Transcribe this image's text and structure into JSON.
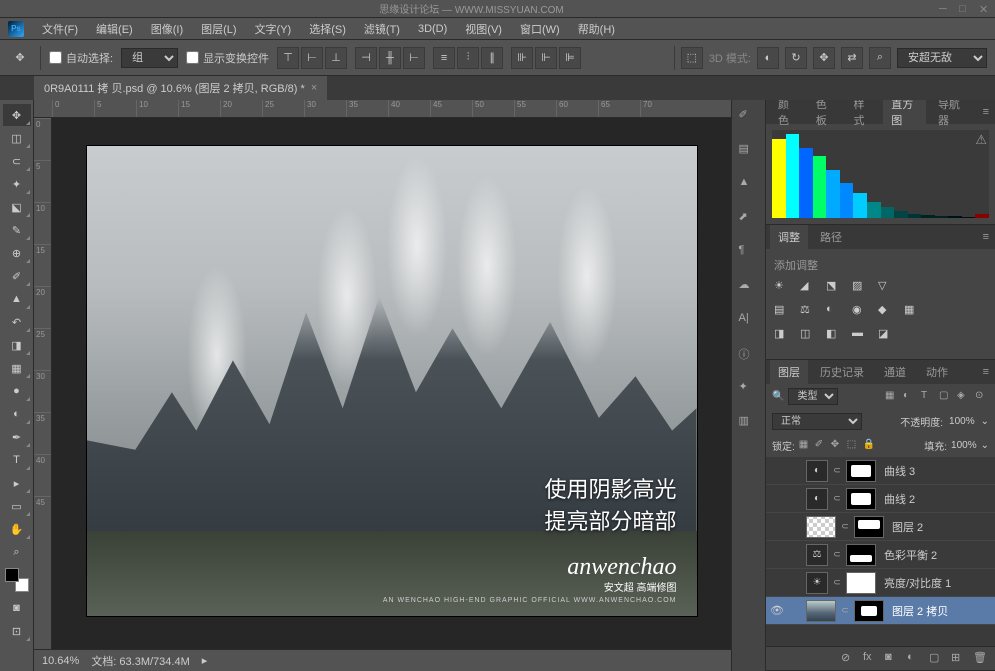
{
  "titlebar": {
    "watermark": "思缘设计论坛 — WWW.MISSYUAN.COM"
  },
  "menu": {
    "items": [
      "文件(F)",
      "编辑(E)",
      "图像(I)",
      "图层(L)",
      "文字(Y)",
      "选择(S)",
      "滤镜(T)",
      "3D(D)",
      "视图(V)",
      "窗口(W)",
      "帮助(H)"
    ]
  },
  "options": {
    "auto_select": "自动选择:",
    "group": "组",
    "show_transform": "显示变换控件",
    "mode_3d": "3D 模式:",
    "preset": "安超无敌组"
  },
  "doctab": {
    "title": "0R9A0111 拷 贝.psd @ 10.6% (图层 2 拷贝, RGB/8) *"
  },
  "ruler_h": [
    "0",
    "5",
    "10",
    "15",
    "20",
    "25",
    "30",
    "35",
    "40",
    "45",
    "50",
    "55",
    "60",
    "65",
    "70"
  ],
  "ruler_v": [
    "0",
    "5",
    "10",
    "15",
    "20",
    "25",
    "30",
    "35",
    "40",
    "45"
  ],
  "artwork": {
    "text1": "使用阴影高光",
    "text2": "提亮部分暗部",
    "logo": "anwenchao",
    "logo_sub": "安文超 高端修图",
    "logo_en": "AN WENCHAO HIGH-END GRAPHIC OFFICIAL WWW.ANWENCHAO.COM"
  },
  "status": {
    "zoom": "10.64%",
    "doc_info": "文档: 63.3M/734.4M"
  },
  "panels": {
    "color_tabs": [
      "颜色",
      "色板",
      "样式",
      "直方图",
      "导航器"
    ],
    "adj_tabs": [
      "调整",
      "路径"
    ],
    "adj_title": "添加调整",
    "layers_tabs": [
      "图层",
      "历史记录",
      "通道",
      "动作"
    ],
    "filter_type": "类型",
    "blend_mode": "正常",
    "opacity_label": "不透明度:",
    "opacity_val": "100%",
    "lock_label": "锁定:",
    "fill_label": "填充:",
    "fill_val": "100%"
  },
  "layers": [
    {
      "name": "曲线 3",
      "type": "adj",
      "visible": false
    },
    {
      "name": "曲线 2",
      "type": "adj",
      "visible": false
    },
    {
      "name": "图层 2",
      "type": "img-trans",
      "visible": false
    },
    {
      "name": "色彩平衡 2",
      "type": "adj",
      "visible": false
    },
    {
      "name": "亮度/对比度 1",
      "type": "adj-white",
      "visible": false
    },
    {
      "name": "图层 2 拷贝",
      "type": "img",
      "visible": true,
      "selected": true
    }
  ]
}
